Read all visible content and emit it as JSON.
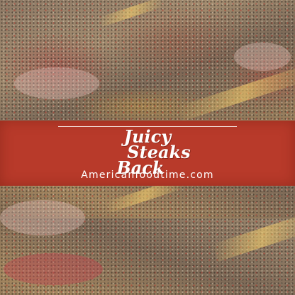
{
  "banner": {
    "title_lines": [
      "Juicy",
      "Steaks",
      "Back"
    ],
    "website": "Americanfoodtime.com"
  },
  "colors": {
    "banner": "#b83a2a",
    "text": "#ffffff"
  }
}
